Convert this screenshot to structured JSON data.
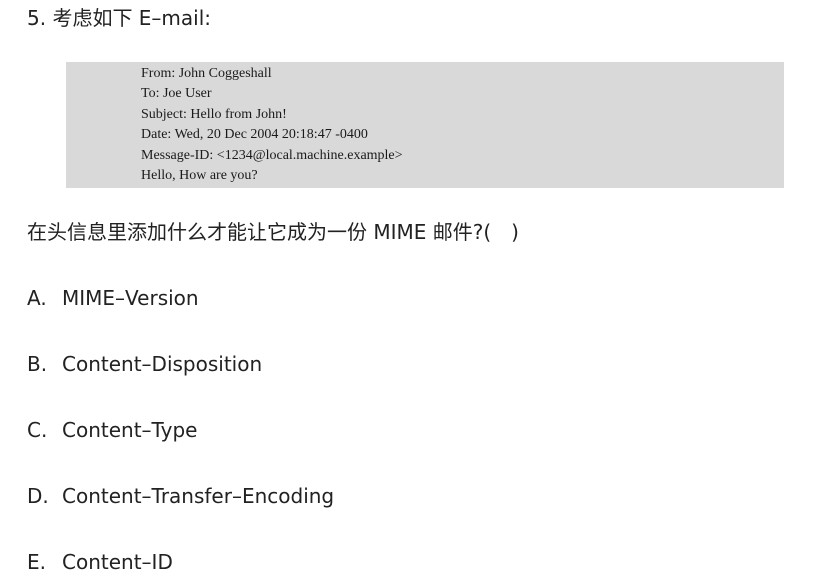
{
  "question": {
    "number_title": "5. 考虑如下 E–mail:",
    "body": "在头信息里添加什么才能让它成为一份 MIME 邮件?(　)"
  },
  "email": {
    "lines": [
      "From: John Coggeshall",
      "To: Joe User",
      "Subject: Hello from John!",
      "Date: Wed, 20 Dec 2004 20:18:47 -0400",
      "Message-ID: <1234@local.machine.example>",
      "Hello, How are you?"
    ]
  },
  "options": [
    {
      "letter": "A.",
      "text": "MIME–Version"
    },
    {
      "letter": "B.",
      "text": "Content–Disposition"
    },
    {
      "letter": "C.",
      "text": "Content–Type"
    },
    {
      "letter": "D.",
      "text": "Content–Transfer–Encoding"
    },
    {
      "letter": "E.",
      "text": "Content–ID"
    }
  ]
}
